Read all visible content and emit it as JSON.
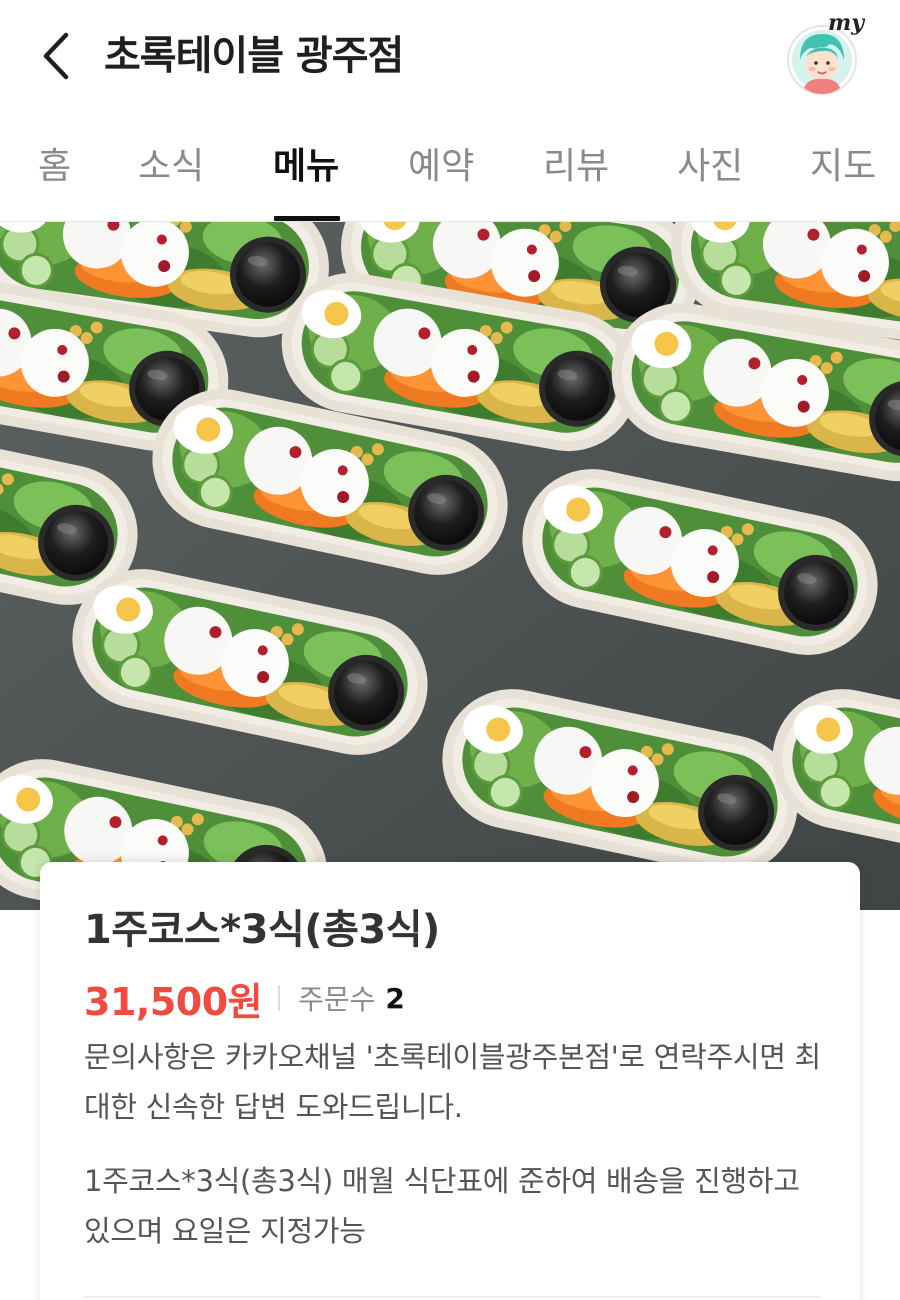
{
  "header": {
    "title": "초록테이블 광주점",
    "my_label": "my"
  },
  "tabs": [
    {
      "label": "홈",
      "active": false
    },
    {
      "label": "소식",
      "active": false
    },
    {
      "label": "메뉴",
      "active": true
    },
    {
      "label": "예약",
      "active": false
    },
    {
      "label": "리뷰",
      "active": false
    },
    {
      "label": "사진",
      "active": false
    },
    {
      "label": "지도",
      "active": false
    }
  ],
  "hero": {
    "icon": "salad-photo"
  },
  "item": {
    "name": "1주코스*3식(총3식)",
    "price": "31,500원",
    "orders_label": "주문수",
    "orders_count": "2",
    "description_1": "문의사항은 카카오채널 '초록테이블광주본점'로 연락주시면 최대한 신속한 답변 도와드립니다.",
    "description_2": "1주코스*3식(총3식) 매월 식단표에 준하여 배송을 진행하고 있으며 요일은 지정가능"
  },
  "colors": {
    "price": "#f04b3e",
    "active_tab": "#111111",
    "inactive_tab": "#8a8a8a"
  }
}
